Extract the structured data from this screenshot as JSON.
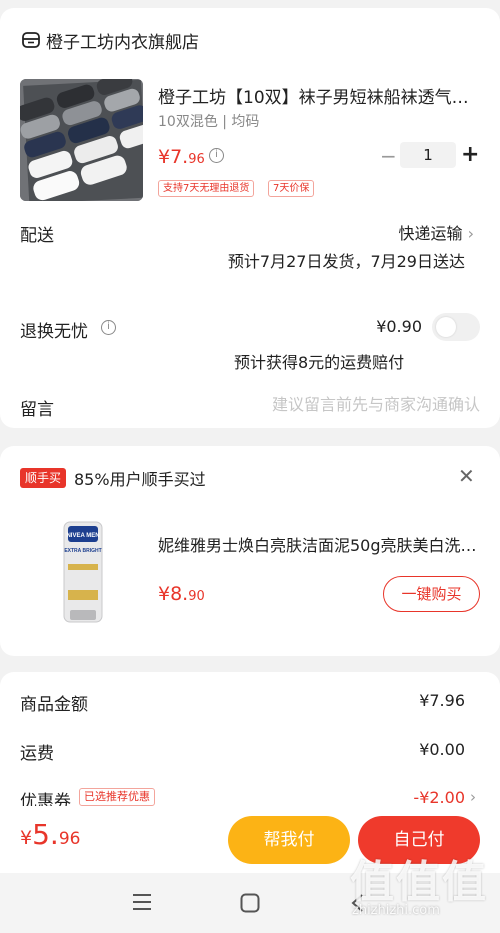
{
  "store": {
    "name": "橙子工坊内衣旗舰店",
    "icon": "store-icon"
  },
  "product": {
    "title": "橙子工坊【10双】袜子男短袜船袜透气…",
    "spec": "10双混色 | 均码",
    "price_symbol": "¥",
    "price_int": "7.",
    "price_dec": "96",
    "quantity": "1",
    "minus": "−",
    "plus": "+",
    "tags": [
      "支持7天无理由退货",
      "7天价保"
    ]
  },
  "delivery": {
    "label": "配送",
    "method": "快递运输",
    "eta": "预计7月27日发货，7月29日送达"
  },
  "returns": {
    "label": "退换无忧",
    "price": "¥0.90",
    "note": "预计获得8元的运费赔付",
    "enabled": false
  },
  "message": {
    "label": "留言",
    "placeholder": "建议留言前先与商家沟通确认"
  },
  "recommend": {
    "badge": "顺手买",
    "headline": "85%用户顺手买过",
    "close": "✕",
    "title": "妮维雅男士焕白亮肤洁面泥50g亮肤美白洗…",
    "price_symbol": "¥",
    "price_int": "8.",
    "price_dec": "90",
    "buy_label": "一键购买",
    "product_logo": "NIVEA MEN",
    "product_sub": "EXTRA BRIGHT"
  },
  "summary": {
    "goods_label": "商品金额",
    "goods_value": "¥7.96",
    "shipping_label": "运费",
    "shipping_value": "¥0.00",
    "coupon_label": "优惠券",
    "coupon_tag": "已选推荐优惠",
    "coupon_value": "-¥2.00"
  },
  "footer": {
    "total_symbol": "¥",
    "total_int": "5.",
    "total_dec": "96",
    "help_pay": "帮我付",
    "self_pay": "自己付"
  },
  "watermark": {
    "glyphs": "值值值",
    "url": "zhizhizhi.com"
  },
  "colors": {
    "accent": "#e8352a",
    "yellow": "#fcb315",
    "red_button": "#ef3a2c"
  }
}
